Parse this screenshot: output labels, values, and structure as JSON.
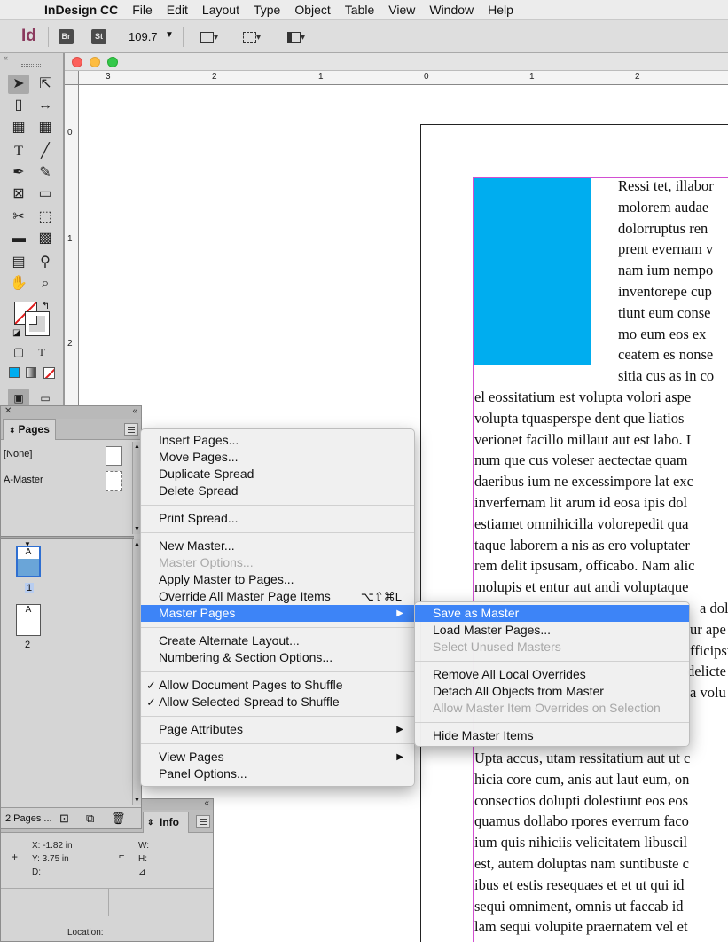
{
  "menubar": {
    "app": "InDesign CC",
    "items": [
      "File",
      "Edit",
      "Layout",
      "Type",
      "Object",
      "Table",
      "View",
      "Window",
      "Help"
    ]
  },
  "appbar": {
    "logo": "Id",
    "bridge": "Br",
    "stock": "St",
    "zoom": "109.7"
  },
  "ruler": {
    "h": [
      "3",
      "2",
      "1",
      "0",
      "1",
      "2"
    ],
    "v": [
      "0",
      "1",
      "2"
    ]
  },
  "document": {
    "text_right": [
      "Ressi tet, illabor",
      "molorem audae",
      "dolorruptus ren",
      "prent evernam v",
      "nam ium nempo",
      "inventorepe cup",
      "tiunt eum conse",
      "mo eum eos ex",
      "ceatem es nonse",
      "sitia cus as in co"
    ],
    "text_full": [
      "el eossitatium est volupta volori aspe",
      "volupta tquasperspe dent que liatios",
      "verionet facillo millaut aut est labo. I",
      "num que cus voleser aectectae quam",
      "daeribus ium ne excessimpore lat exc",
      "inverfernam lit arum id eosa ipis dol",
      "estiamet omnihicilla volorepedit qua",
      "taque laborem a nis as ero voluptater",
      "rem delit ipsusam, officabo. Nam alic",
      "molupis et entur aut andi voluptaque",
      "a dolu",
      "ur ape",
      "fficipst",
      "delicte",
      "a volu"
    ],
    "text_lower": [
      "Upta accus, utam ressitatium aut ut c",
      "hicia core cum, anis aut laut eum, on",
      "consectios dolupti dolestiunt eos eos",
      "quamus dollabo rpores everrum faco",
      "ium quis nihiciis velicitatem libuscil",
      "est, autem doluptas nam suntibuste c",
      "ibus et estis resequaes et et ut qui id",
      "sequi omniment, omnis ut faccab id",
      "lam sequi volupite praernatem vel et"
    ]
  },
  "pages_panel": {
    "tab": "Pages",
    "masters": [
      {
        "label": "[None]"
      },
      {
        "label": "A-Master"
      }
    ],
    "pages": [
      {
        "number": "1",
        "prefix": "A"
      },
      {
        "number": "2",
        "prefix": "A"
      }
    ],
    "footer": "2 Pages ..."
  },
  "info_panel": {
    "tab": "Info",
    "x": "X: -1.82 in",
    "y": "Y: 3.75 in",
    "d": "D:",
    "w": "W:",
    "h": "H:",
    "angle": "⊿",
    "location": "Location:"
  },
  "context_menu": {
    "insert_pages": "Insert Pages...",
    "move_pages": "Move Pages...",
    "duplicate_spread": "Duplicate Spread",
    "delete_spread": "Delete Spread",
    "print_spread": "Print Spread...",
    "new_master": "New Master...",
    "master_options": "Master Options...",
    "apply_master": "Apply Master to Pages...",
    "override_all": "Override All Master Page Items",
    "override_shortcut": "⌥⇧⌘L",
    "master_pages": "Master Pages",
    "create_alternate": "Create Alternate Layout...",
    "numbering": "Numbering & Section Options...",
    "allow_doc_shuffle": "Allow Document Pages to Shuffle",
    "allow_spread_shuffle": "Allow Selected Spread to Shuffle",
    "page_attributes": "Page Attributes",
    "view_pages": "View Pages",
    "panel_options": "Panel Options..."
  },
  "submenu": {
    "save_as_master": "Save as Master",
    "load_master_pages": "Load Master Pages...",
    "select_unused": "Select Unused Masters",
    "remove_overrides": "Remove All Local Overrides",
    "detach_objects": "Detach All Objects from Master",
    "allow_overrides": "Allow Master Item Overrides on Selection",
    "hide_master_items": "Hide Master Items"
  },
  "colors": {
    "selection": "#3d84f7",
    "frame_fill": "#00adef",
    "margin_guide": "#d24fd2",
    "app_brand": "#8b3a5e"
  }
}
